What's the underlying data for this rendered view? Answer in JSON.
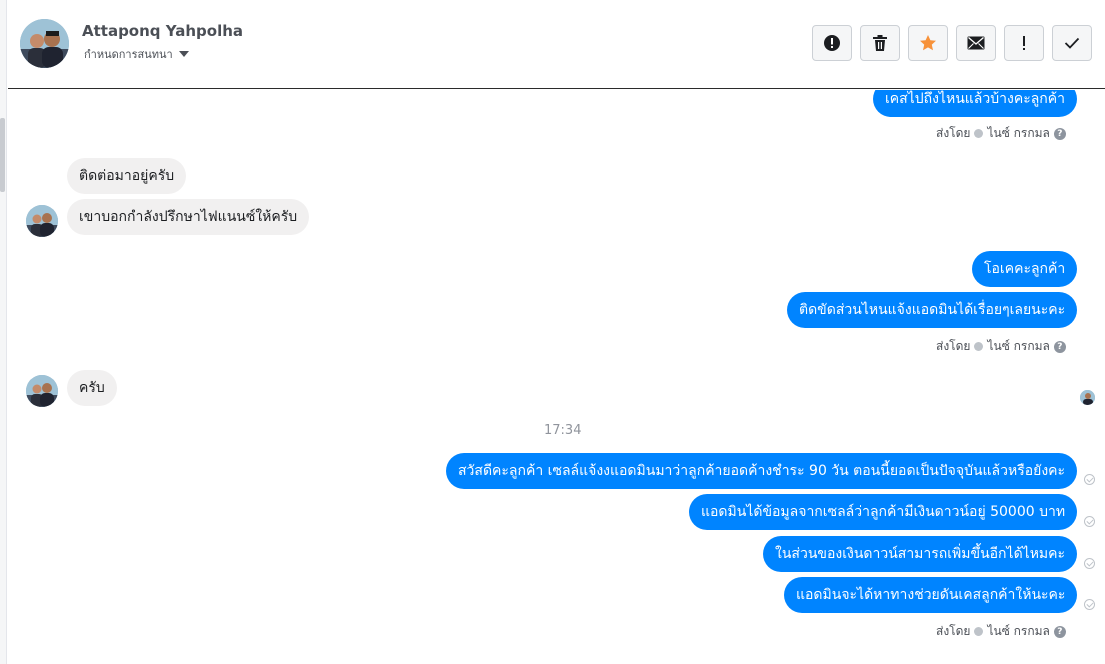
{
  "header": {
    "name": "Attaponq Yahpolha",
    "subtitle": "กำหนดการสนทนา"
  },
  "toolbar": {
    "buttons": [
      {
        "icon": "exclamation-circle-icon"
      },
      {
        "icon": "trash-icon"
      },
      {
        "icon": "star-icon",
        "color": "#f7923a"
      },
      {
        "icon": "envelope-icon"
      },
      {
        "icon": "exclamation-icon"
      },
      {
        "icon": "check-icon"
      }
    ]
  },
  "messages": {
    "m1": "เคสไปถึงไหนแล้วบ้างคะลูกค้า",
    "m2": "ติดต่อมาอยู่ครับ",
    "m3": "เขาบอกกำลังปรึกษาไฟแนนซ์ให้ครับ",
    "m4": "โอเคคะลูกค้า",
    "m5": "ติดขัดส่วนไหนแจ้งแอดมินได้เรื่อยๆเลยนะคะ",
    "m6": "ครับ",
    "m7": "สวัสดีคะลูกค้า เซลล์แจ้งงแอดมินมาว่าลูกค้ายอดค้างชำระ 90 วัน ตอนนี้ยอดเป็นปัจจุบันแล้วหรือยังคะ",
    "m8": "แอดมินได้ข้อมูลจากเซลล์ว่าลูกค้ามีเงินดาวน์อยู่ 50000 บาท",
    "m9": "ในส่วนของเงินดาวน์สามารถเพิ่มขึ้นอีกได้ไหมคะ",
    "m10": "แอดมินจะได้หาทางช่วยดันเคสลูกค้าให้นะคะ"
  },
  "sent_by": {
    "prefix": "ส่งโดย",
    "sender": "ไนซ์ กรกมล"
  },
  "timestamp": "17:34",
  "colors": {
    "outgoing": "#0084ff",
    "incoming": "#f1f0f0"
  }
}
